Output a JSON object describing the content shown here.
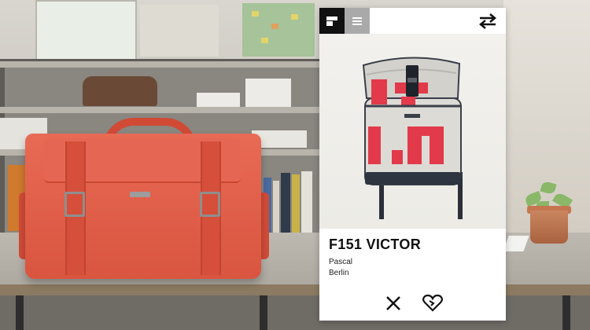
{
  "app": {
    "header": {
      "logo_icon": "freitag-f-logo-icon",
      "menu_icon": "hamburger-menu-icon",
      "swap_icon": "swap-arrows-icon"
    },
    "product": {
      "image_icon": "messenger-backpack-image",
      "title": "F151 VICTOR",
      "owner": "Pascal",
      "city": "Berlin"
    },
    "actions": {
      "reject_icon": "close-x-icon",
      "like_icon": "heart-icon"
    }
  },
  "colors": {
    "panel": "#ffffff",
    "logo_bg": "#111111",
    "menu_bg": "#a9a9a9",
    "text": "#111111",
    "bag_red": "#e05a44",
    "tarp_red": "#e23a4a"
  }
}
